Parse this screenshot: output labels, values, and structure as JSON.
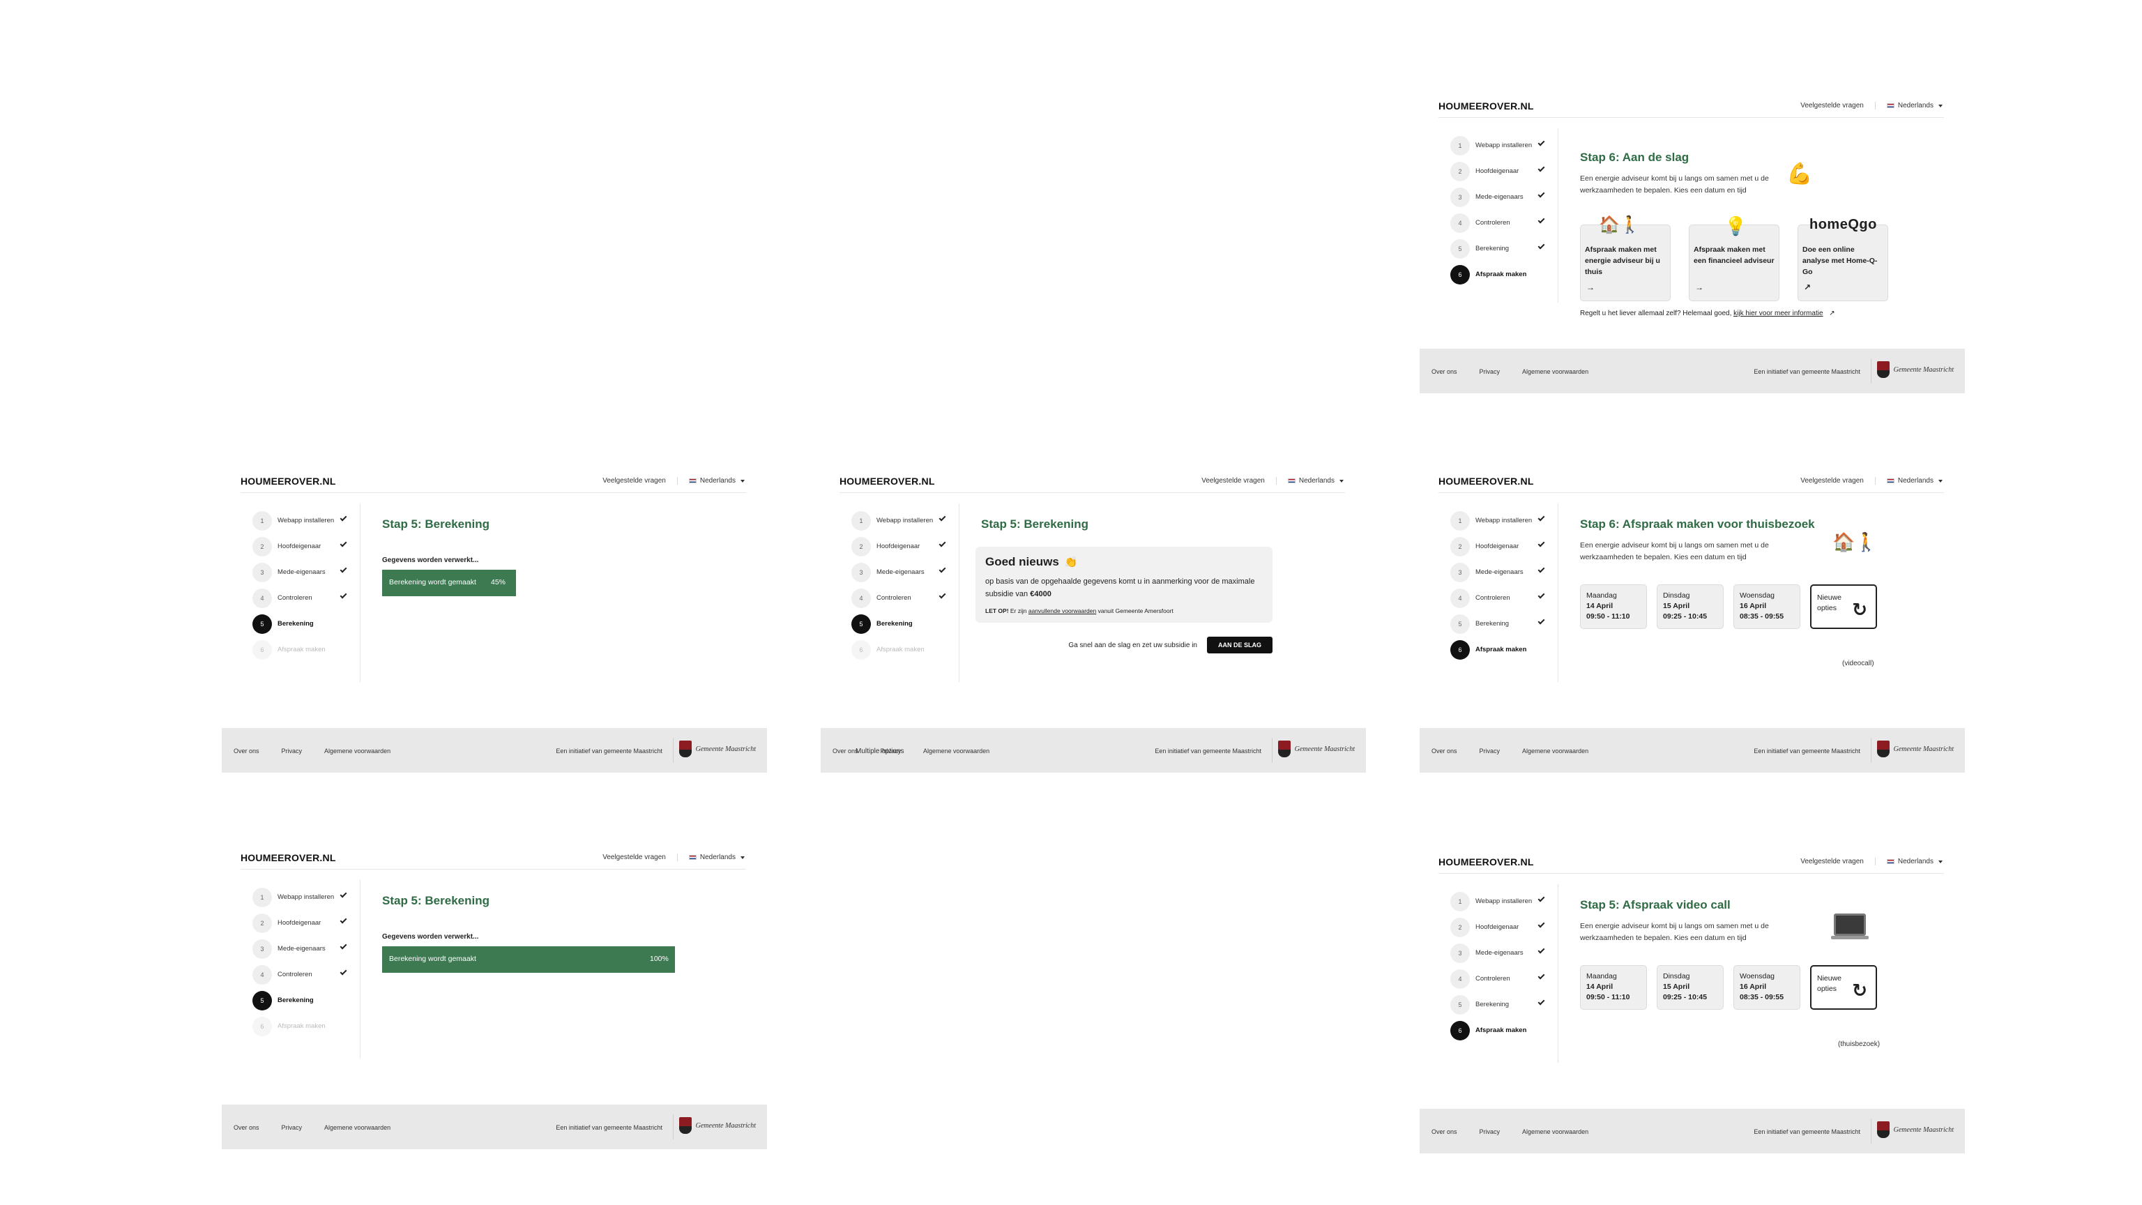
{
  "brand": "HOUMEEROVER.NL",
  "nav": {
    "faq": "Veelgestelde vragen",
    "language": "Nederlands"
  },
  "steps": [
    "Webapp installeren",
    "Hoofdeigenaar",
    "Mede-eigenaars",
    "Controleren",
    "Berekening",
    "Afspraak maken"
  ],
  "step_numbers": [
    "1",
    "2",
    "3",
    "4",
    "5",
    "6"
  ],
  "footer": {
    "over": "Over ons",
    "privacy": "Privacy",
    "voorwaarden": "Algemene voorwaarden",
    "initiatief": "Een initiatief van gemeente Maastricht",
    "logo_text": "Gemeente Maastricht"
  },
  "screen_aan_de_slag": {
    "title": "Stap 6: Aan de slag",
    "description": "Een energie adviseur komt bij u langs om samen met u de werkzaamheden te bepalen. Kies een datum en tijd",
    "emoji": "💪",
    "cards": [
      {
        "emoji": "🏠🚶",
        "label": "Afspraak maken met energie adviseur bij u thuis",
        "arrow": "→"
      },
      {
        "emoji": "💡",
        "label": "Afspraak maken met een financieel adviseur",
        "arrow": "→"
      },
      {
        "logo": "homeQgo",
        "label": "Doe een online analyse met Home-Q-Go",
        "arrow": "↗"
      }
    ],
    "more_prefix": "Regelt u het liever allemaal zelf? Helemaal goed, ",
    "more_link": "kijk hier voor meer informatie",
    "more_icon": "↗"
  },
  "screen_berekening_45": {
    "title": "Stap 5: Berekening",
    "processing": "Gegevens worden verwerkt...",
    "bar_label": "Berekening wordt gemaakt",
    "progress_text": "45%",
    "progress": 0.45
  },
  "screen_goed_nieuws": {
    "title": "Stap 5: Berekening",
    "news_title": "Goed nieuws",
    "news_emoji": "👏",
    "news_text": "op basis van de opgehaalde gegevens komt u in aanmerking voor de maximale subsidie van",
    "amount": "€4000",
    "note_bold": "LET OP!",
    "note_pre": " Er zijn ",
    "note_link": "aanvullende voorwaarden",
    "note_post": " vanuit Gemeente Amersfoort",
    "cta_text": "Ga snel aan de slag en zet uw subsidie in",
    "cta_button": "AAN DE SLAG",
    "overlay": "Multiple options"
  },
  "screen_thuisbezoek": {
    "title": "Stap 6: Afspraak maken voor thuisbezoek",
    "description": "Een energie adviseur komt bij u langs om samen met u de werkzaamheden te bepalen. Kies een datum en tijd",
    "emoji": "🏠🚶",
    "slots": [
      {
        "day": "Maandag",
        "date": "14 April",
        "time": "09:50 - 11:10"
      },
      {
        "day": "Dinsdag",
        "date": "15 April",
        "time": "09:25 - 10:45"
      },
      {
        "day": "Woensdag",
        "date": "16 April",
        "time": "08:35 - 09:55"
      }
    ],
    "other": "Nieuwe opties",
    "other_icon": "↻",
    "alt": "(videocall)"
  },
  "screen_berekening_100": {
    "title": "Stap 5: Berekening",
    "processing": "Gegevens worden verwerkt...",
    "bar_label": "Berekening wordt gemaakt",
    "progress_text": "100%",
    "progress": 1.0
  },
  "screen_videocall": {
    "title": "Stap 5: Afspraak video call",
    "description": "Een energie adviseur komt bij u langs om samen met u de werkzaamheden te bepalen. Kies een datum en tijd",
    "slots": [
      {
        "day": "Maandag",
        "date": "14 April",
        "time": "09:50 - 11:10"
      },
      {
        "day": "Dinsdag",
        "date": "15 April",
        "time": "09:25 - 10:45"
      },
      {
        "day": "Woensdag",
        "date": "16 April",
        "time": "08:35 - 09:55"
      }
    ],
    "other": "Nieuwe opties",
    "other_icon": "↻",
    "alt": "(thuisbezoek)"
  }
}
